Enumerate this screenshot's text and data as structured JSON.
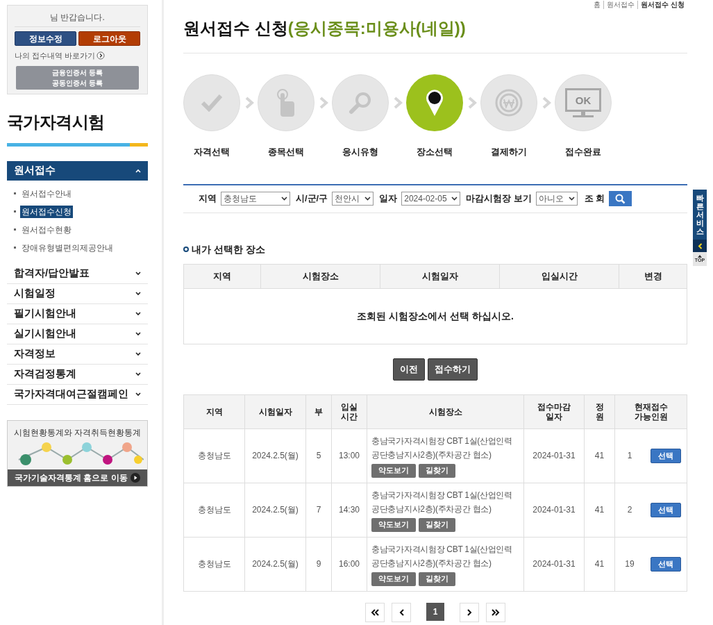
{
  "user_box": {
    "greeting": "님 반갑습니다.",
    "buttons": [
      {
        "label": "정보수정",
        "kind": "primary"
      },
      {
        "label": "로그아웃",
        "kind": "danger"
      }
    ],
    "link": "나의 접수내역 바로가기",
    "cert_button": [
      "금융인증서 등록",
      "공동인증서 등록"
    ]
  },
  "sidebar": {
    "title": "국가자격시험",
    "menus": [
      {
        "label": "원서접수",
        "expanded": true,
        "children": [
          {
            "label": "원서접수안내",
            "selected": false
          },
          {
            "label": "원서접수신청",
            "selected": true
          },
          {
            "label": "원서접수현황",
            "selected": false
          },
          {
            "label": "장애유형별편의제공안내",
            "selected": false
          }
        ]
      },
      {
        "label": "합격자/답안발표",
        "expanded": false
      },
      {
        "label": "시험일정",
        "expanded": false
      },
      {
        "label": "필기시험안내",
        "expanded": false
      },
      {
        "label": "실기시험안내",
        "expanded": false
      },
      {
        "label": "자격정보",
        "expanded": false
      },
      {
        "label": "자격검정통계",
        "expanded": false
      },
      {
        "label": "국가자격대여근절캠페인",
        "expanded": false
      }
    ],
    "banner": {
      "title": "시험현황통계와 자격취득현황통계",
      "link": "국가기술자격통계 홈으로 이동"
    }
  },
  "breadcrumb": [
    "홈",
    "원서접수",
    "원서접수 신청"
  ],
  "page_title": {
    "main": "원서접수 신청",
    "sub": "(응시종목:미용사(네일))"
  },
  "steps": [
    {
      "label": "자격선택",
      "selected": false
    },
    {
      "label": "종목선택",
      "selected": false
    },
    {
      "label": "응시유형",
      "selected": false
    },
    {
      "label": "장소선택",
      "selected": true
    },
    {
      "label": "결제하기",
      "selected": false
    },
    {
      "label": "접수완료",
      "screen_text": "OK",
      "selected": false
    }
  ],
  "filters": [
    {
      "label": "지역",
      "value": "충청남도"
    },
    {
      "label": "시/군/구",
      "value": "천안시"
    },
    {
      "label": "일자",
      "value": "2024-02-05"
    },
    {
      "label": "마감시험장 보기",
      "value": "아니오"
    }
  ],
  "search_label": "조 회",
  "my_place": {
    "title": "내가 선택한 장소",
    "columns": [
      "지역",
      "시험장소",
      "시험일자",
      "입실시간",
      "변경"
    ],
    "empty_message": "조회된 시험장소에서 선택 하십시오."
  },
  "actions": [
    "이전",
    "접수하기"
  ],
  "results": {
    "columns": [
      "지역",
      "시험일자",
      "부",
      "입실 시간",
      "시험장소",
      "접수마감 일자",
      "정 원",
      "현재접수 가능인원"
    ],
    "rows": [
      {
        "region": "충청남도",
        "date": "2024.2.5(월)",
        "session": "5",
        "time": "13:00",
        "place": "충남국가자격시험장 CBT 1실(산업인력공단충남지사2층)(주차공간 협소)",
        "map_button": "약도보기",
        "route_button": "길찾기",
        "deadline": "2024-01-31",
        "capacity": "41",
        "available": "1",
        "select_button": "선택"
      },
      {
        "region": "충청남도",
        "date": "2024.2.5(월)",
        "session": "7",
        "time": "14:30",
        "place": "충남국가자격시험장 CBT 1실(산업인력공단충남지사2층)(주차공간 협소)",
        "map_button": "약도보기",
        "route_button": "길찾기",
        "deadline": "2024-01-31",
        "capacity": "41",
        "available": "2",
        "select_button": "선택"
      },
      {
        "region": "충청남도",
        "date": "2024.2.5(월)",
        "session": "9",
        "time": "16:00",
        "place": "충남국가자격시험장 CBT 1실(산업인력공단충남지사2층)(주차공간 협소)",
        "map_button": "약도보기",
        "route_button": "길찾기",
        "deadline": "2024-01-31",
        "capacity": "41",
        "available": "19",
        "select_button": "선택"
      }
    ]
  },
  "pagination": {
    "pages": [
      {
        "label": "1",
        "selected": true
      }
    ]
  },
  "quick_service": {
    "label": "빠른서비스",
    "top": "TOP"
  }
}
